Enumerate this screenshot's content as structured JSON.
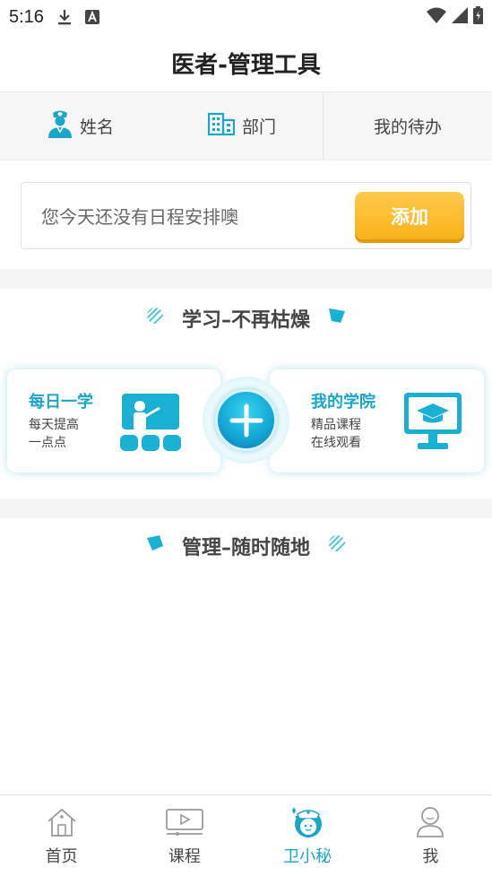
{
  "status_bar": {
    "time": "5:16"
  },
  "header": {
    "title": "医者-管理工具"
  },
  "info_row": {
    "name_label": "姓名",
    "dept_label": "部门",
    "todo_label": "我的待办"
  },
  "schedule": {
    "empty_text": "您今天还没有日程安排噢",
    "add_label": "添加"
  },
  "study_section": {
    "title": "学习–不再枯燥"
  },
  "cards": {
    "daily": {
      "title": "每日一学",
      "line1": "每天提高",
      "line2": "一点点"
    },
    "academy": {
      "title": "我的学院",
      "line1": "精品课程",
      "line2": "在线观看"
    }
  },
  "manage_section": {
    "title": "管理–随时随地"
  },
  "tabs": [
    {
      "label": "首页",
      "icon": "home-icon"
    },
    {
      "label": "课程",
      "icon": "video-icon"
    },
    {
      "label": "卫小秘",
      "icon": "nurse-icon",
      "active": true
    },
    {
      "label": "我",
      "icon": "person-icon"
    }
  ],
  "colors": {
    "accent": "#1aa6c9",
    "add_button": "#f8b21b"
  }
}
